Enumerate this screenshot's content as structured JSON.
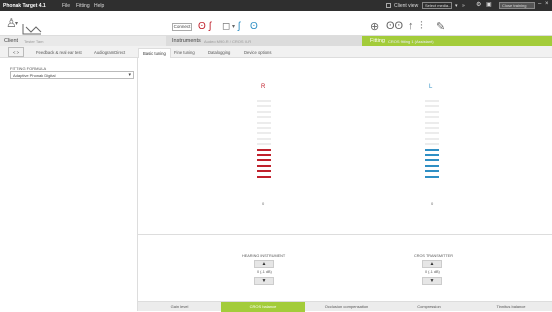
{
  "titlebar": {
    "app_title": "Phonak Target 4.1",
    "menu": [
      "File",
      "Fitting",
      "Help"
    ],
    "client_view": "Client view",
    "select_media": "Select media...",
    "close_training": "Close training"
  },
  "toolbar": {
    "connect": "Connect"
  },
  "sections": {
    "client_label": "Client",
    "client_sub": "Tester Tam",
    "instruments_label": "Instruments",
    "instruments_sub": "Audeo M90-R / CROS II-R",
    "fitting_label": "Fitting",
    "fitting_sub": "CROS fitting 1 (Assistant)"
  },
  "tabs": {
    "nav": "< >",
    "items": [
      "Feedback & real ear test",
      "AudiogramDirect",
      "Basic tuning",
      "Fine tuning",
      "Datalogging",
      "Device options"
    ],
    "active_index": 2
  },
  "left": {
    "formula_label": "FITTING FORMULA",
    "formula_value": "Adaptive Phonak Digital"
  },
  "main": {
    "right_side_letter": "R",
    "left_side_letter": "L",
    "right_value": "0",
    "left_value": "0",
    "right_level_bars": 6,
    "left_level_bars": 6,
    "hi_label": "HEARING INSTRUMENT",
    "hi_value": "0 (-1 dB)",
    "cros_label": "CROS TRANSMITTER",
    "cros_value": "0 (-1 dB)",
    "up_glyph": "▲",
    "down_glyph": "▼"
  },
  "bottom_tabs": {
    "items": [
      "Gain level",
      "CROS balance",
      "Occlusion compensation",
      "Compression",
      "Tinnitus balance"
    ],
    "active_index": 1
  },
  "colors": {
    "right": "#c0212c",
    "left": "#2f8fc4",
    "fitting_green": "#a3cc3a"
  }
}
